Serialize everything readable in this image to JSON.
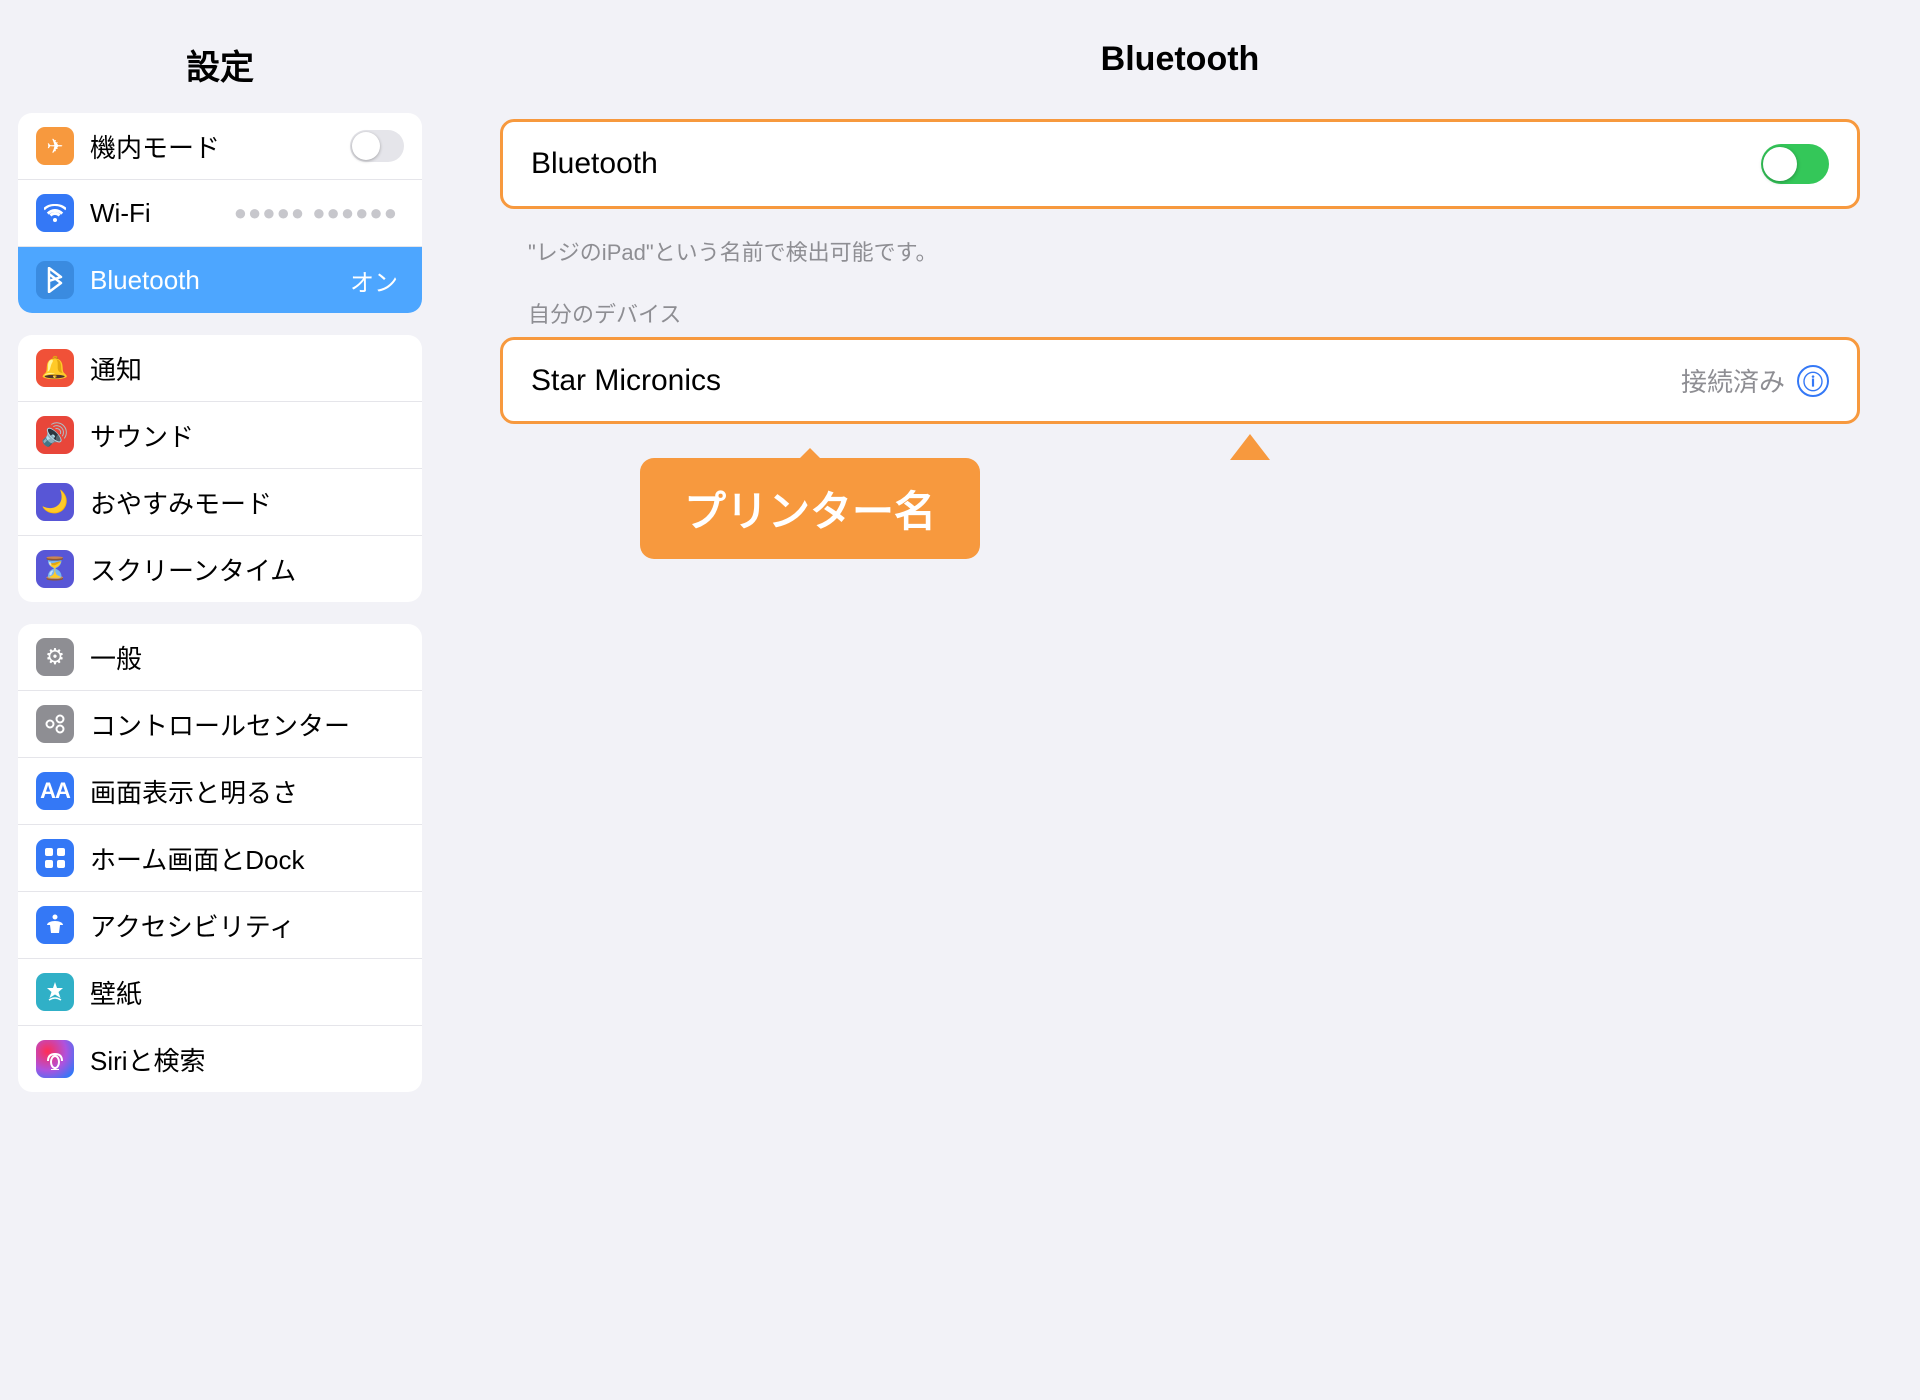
{
  "sidebar": {
    "title": "設定",
    "groups": [
      {
        "id": "group1",
        "items": [
          {
            "id": "airplane",
            "label": "機内モード",
            "icon": "airplane",
            "iconBg": "#f7993e",
            "iconChar": "✈",
            "hasToggle": true,
            "toggleOn": false,
            "active": false
          },
          {
            "id": "wifi",
            "label": "Wi-Fi",
            "icon": "wifi",
            "iconBg": "#3478f6",
            "iconChar": "wifi",
            "value": "●●●●● ●●●●●●",
            "active": false
          },
          {
            "id": "bluetooth",
            "label": "Bluetooth",
            "icon": "bluetooth",
            "iconBg": "#3478f6",
            "iconChar": "bt",
            "value": "オン",
            "active": true
          }
        ]
      },
      {
        "id": "group2",
        "items": [
          {
            "id": "notification",
            "label": "通知",
            "icon": "notification",
            "iconBg": "#f05138",
            "iconChar": "🔔",
            "active": false
          },
          {
            "id": "sound",
            "label": "サウンド",
            "icon": "sound",
            "iconBg": "#e8463a",
            "iconChar": "🔊",
            "active": false
          },
          {
            "id": "donotdisturb",
            "label": "おやすみモード",
            "icon": "donotdisturb",
            "iconBg": "#5856d6",
            "iconChar": "🌙",
            "active": false
          },
          {
            "id": "screentime",
            "label": "スクリーンタイム",
            "icon": "screentime",
            "iconBg": "#5856d6",
            "iconChar": "⏳",
            "active": false
          }
        ]
      },
      {
        "id": "group3",
        "items": [
          {
            "id": "general",
            "label": "一般",
            "icon": "general",
            "iconBg": "#8e8e93",
            "iconChar": "⚙",
            "active": false
          },
          {
            "id": "controlcenter",
            "label": "コントロールセンター",
            "icon": "controlcenter",
            "iconBg": "#8e8e93",
            "iconChar": "☰",
            "active": false
          },
          {
            "id": "display",
            "label": "画面表示と明るさ",
            "icon": "display",
            "iconBg": "#3478f6",
            "iconChar": "A",
            "active": false
          },
          {
            "id": "home",
            "label": "ホーム画面とDock",
            "icon": "home",
            "iconBg": "#3478f6",
            "iconChar": "⠿",
            "active": false
          },
          {
            "id": "accessibility",
            "label": "アクセシビリティ",
            "icon": "accessibility",
            "iconBg": "#3478f6",
            "iconChar": "♿",
            "active": false
          },
          {
            "id": "wallpaper",
            "label": "壁紙",
            "icon": "wallpaper",
            "iconBg": "#30b0c7",
            "iconChar": "❄",
            "active": false
          },
          {
            "id": "siri",
            "label": "Siriと検索",
            "icon": "siri",
            "iconBg": "gradient",
            "iconChar": "S",
            "active": false
          }
        ]
      }
    ]
  },
  "main": {
    "title": "Bluetooth",
    "bluetooth_label": "Bluetooth",
    "bluetooth_on": true,
    "discovery_text": "\"レジのiPad\"という名前で検出可能です。",
    "my_devices_label": "自分のデバイス",
    "device_name": "Star Micronics",
    "device_status": "接続済み",
    "printer_tooltip": "プリンター名"
  }
}
